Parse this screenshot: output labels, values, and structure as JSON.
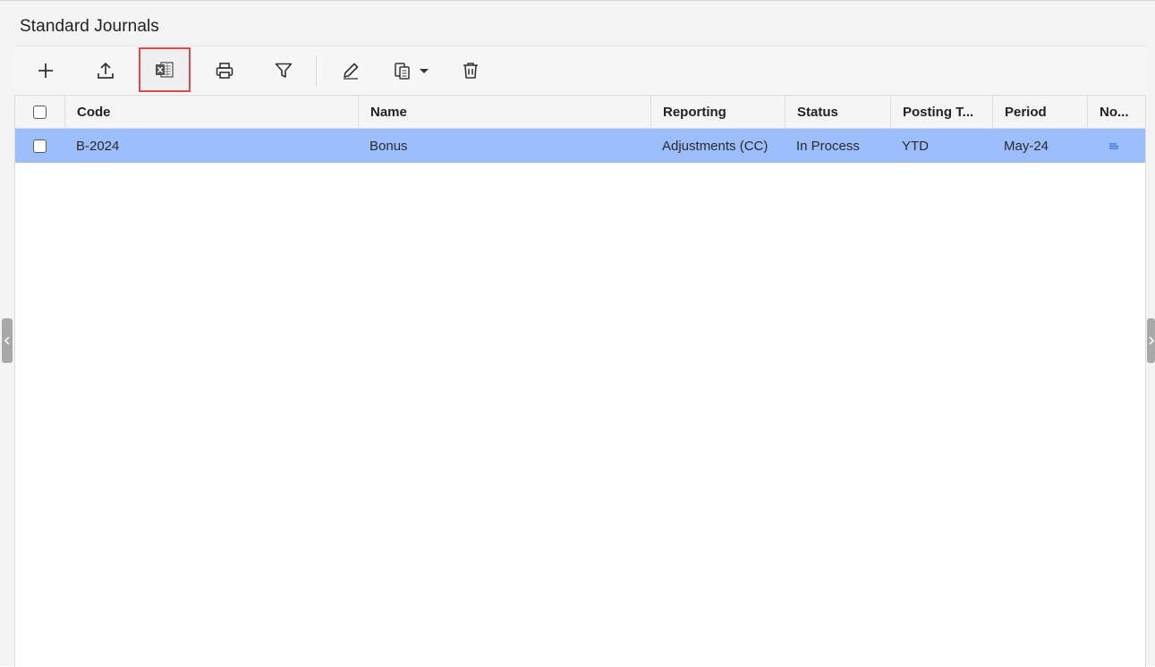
{
  "page": {
    "title": "Standard Journals"
  },
  "toolbar": {
    "buttons": [
      {
        "name": "add",
        "icon": "plus-icon"
      },
      {
        "name": "upload",
        "icon": "upload-icon"
      },
      {
        "name": "export-excel",
        "icon": "excel-icon",
        "highlighted": true
      },
      {
        "name": "print",
        "icon": "printer-icon"
      },
      {
        "name": "filter",
        "icon": "filter-icon"
      },
      {
        "name": "edit",
        "icon": "pencil-icon"
      },
      {
        "name": "copy",
        "icon": "copy-dropdown-icon"
      },
      {
        "name": "delete",
        "icon": "trash-icon"
      }
    ],
    "highlight_color": "#e0464a"
  },
  "grid": {
    "columns": [
      "Code",
      "Name",
      "Reporting",
      "Status",
      "Posting T...",
      "Period",
      "No..."
    ],
    "rows": [
      {
        "code": "B-2024",
        "name": "Bonus",
        "reporting": "Adjustments (CC)",
        "status": "In Process",
        "posting_type": "YTD",
        "period": "May-24",
        "notes_icon": "note-lines-icon",
        "selected": true
      }
    ],
    "selected_row_color": "#9dbefc"
  },
  "side_handles": {
    "left_icon": "chevron-left-icon",
    "right_icon": "chevron-right-icon"
  }
}
